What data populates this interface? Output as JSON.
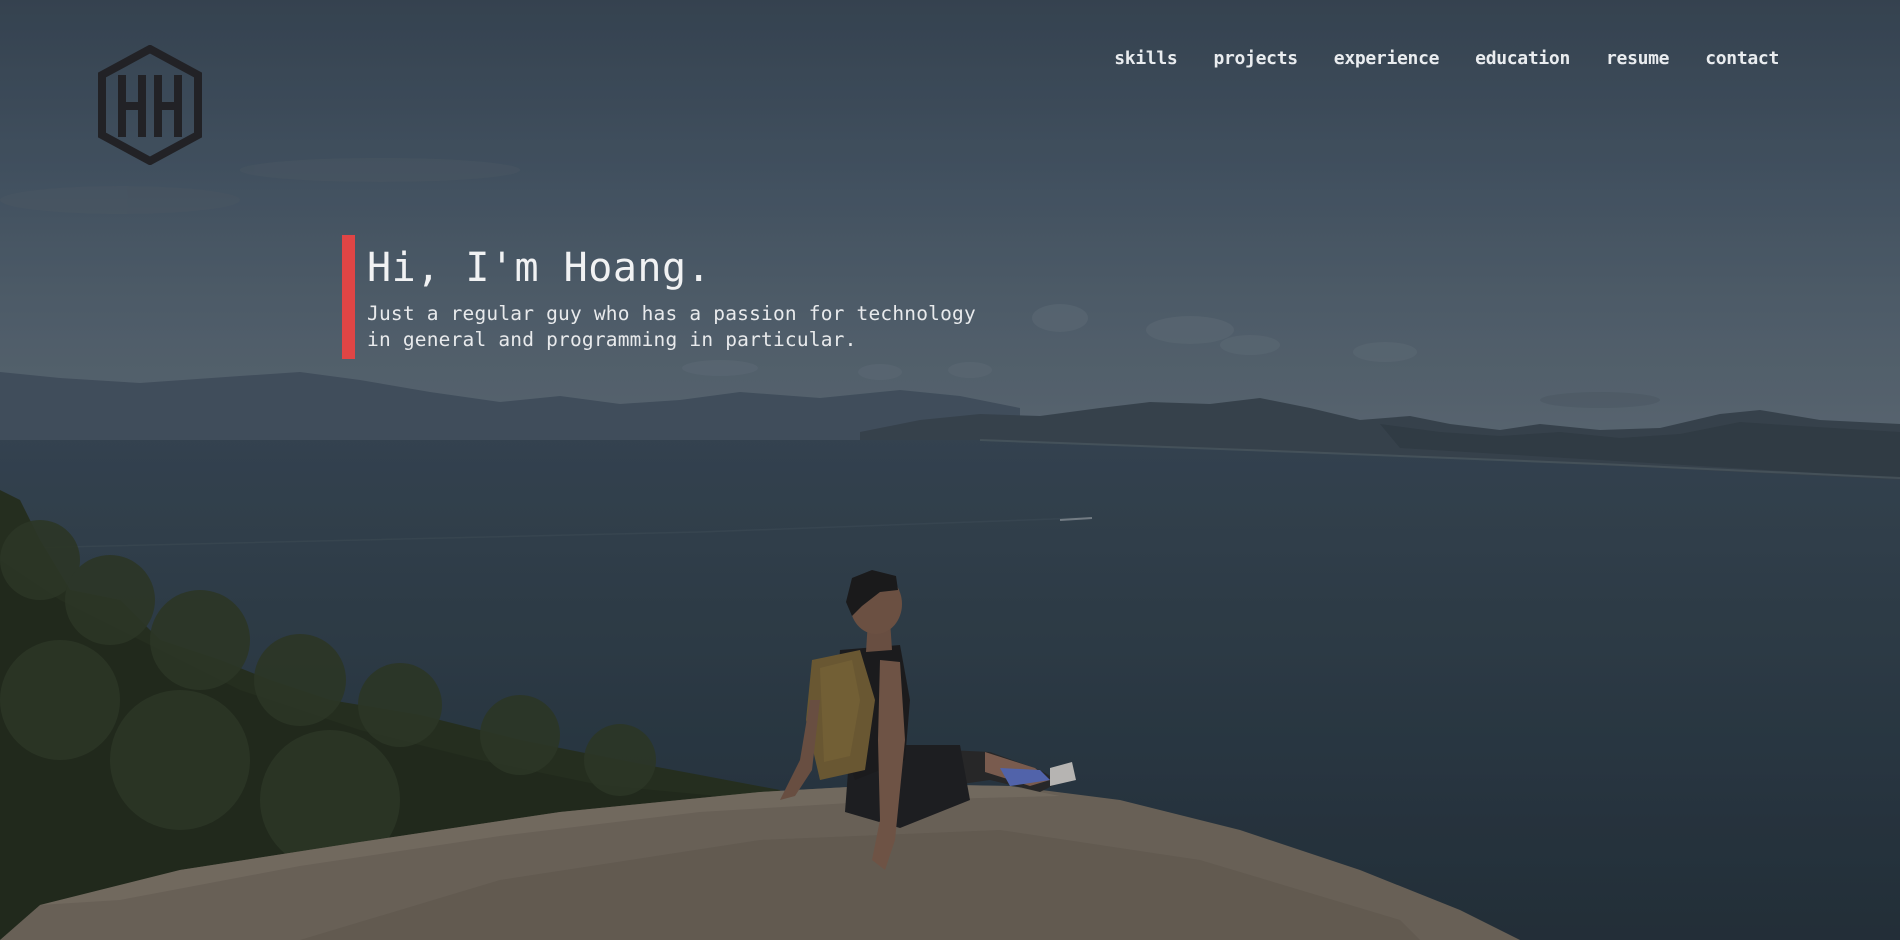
{
  "logo": {
    "icon": "hexagon-hh-logo-icon",
    "color": "#222226"
  },
  "nav": {
    "items": [
      {
        "label": "skills"
      },
      {
        "label": "projects"
      },
      {
        "label": "experience"
      },
      {
        "label": "education"
      },
      {
        "label": "resume"
      },
      {
        "label": "contact"
      }
    ]
  },
  "intro": {
    "heading": "Hi, I'm Hoang.",
    "tagline": "Just a regular guy who has a passion for technology in general and programming in particular.",
    "accent_color": "#e04545"
  }
}
